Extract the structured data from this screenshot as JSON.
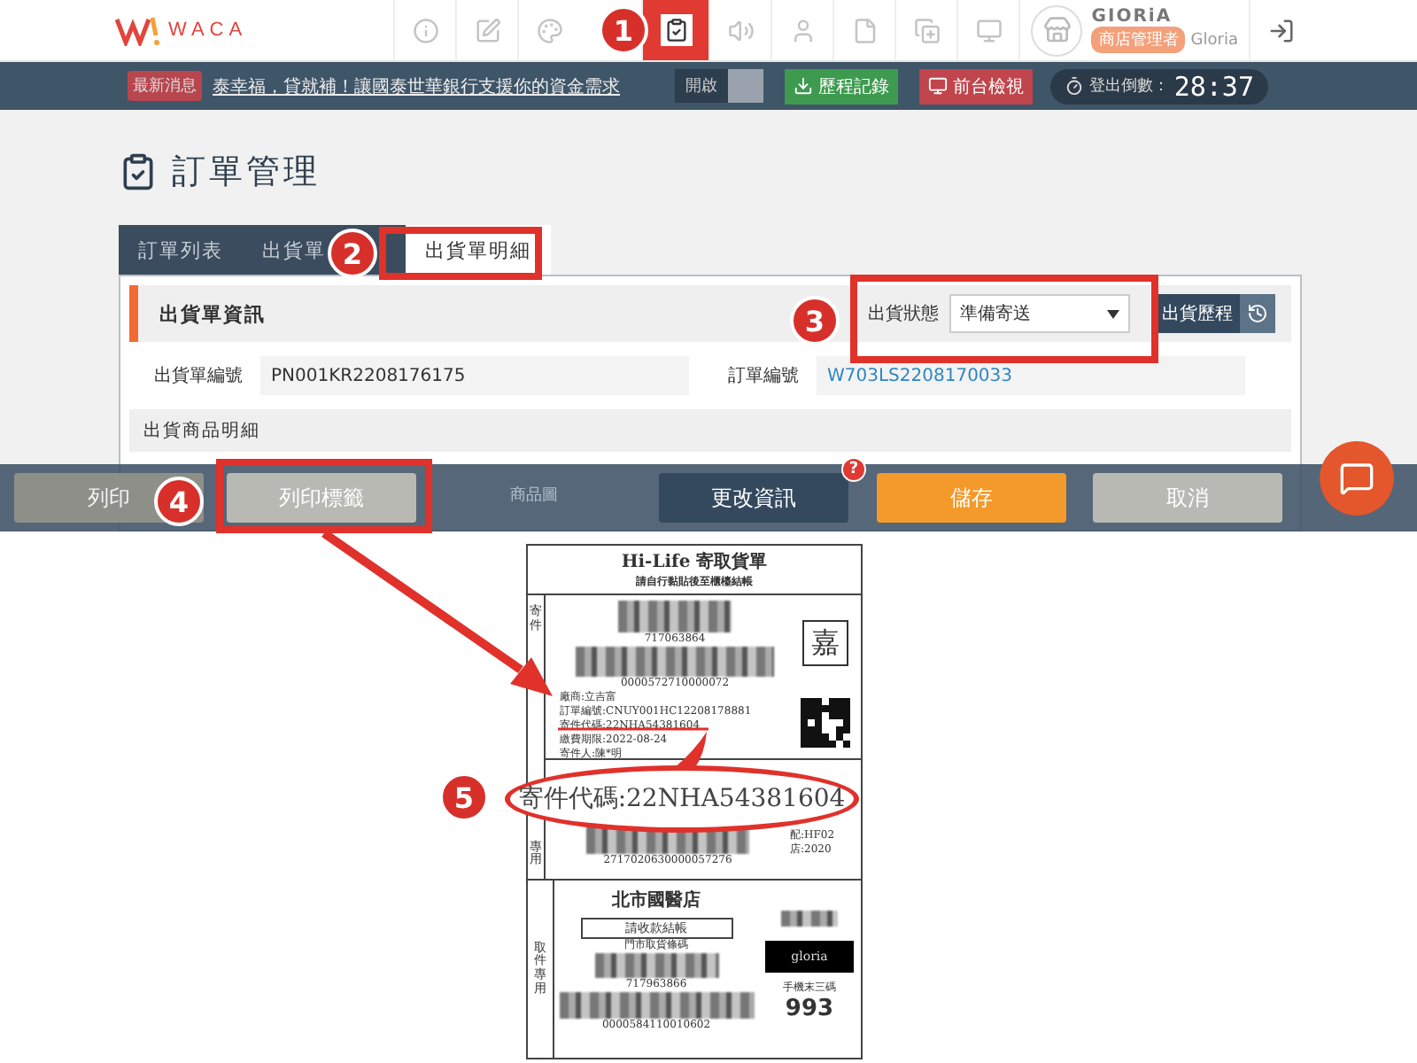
{
  "header": {
    "logo": "WACA",
    "nav": [
      {
        "kind": "info",
        "selected": false
      },
      {
        "kind": "edit",
        "selected": false
      },
      {
        "kind": "palette",
        "selected": false
      },
      {
        "kind": "clipboard",
        "selected": true
      },
      {
        "kind": "speaker",
        "selected": false
      },
      {
        "kind": "user",
        "selected": false
      },
      {
        "kind": "file",
        "selected": false
      },
      {
        "kind": "copy",
        "selected": false
      },
      {
        "kind": "monitor",
        "selected": false
      }
    ],
    "user": {
      "name": "GIORiA",
      "role": "商店管理者",
      "account": "Gloria"
    }
  },
  "news_bar": {
    "badge": "最新消息",
    "headline": "泰幸福，貸就補！讓國泰世華銀行支援你的資金需求",
    "toggle_label": "開啟",
    "toggle_on": false,
    "history_button": "歷程記錄",
    "preview_button": "前台檢視",
    "countdown_label": "登出倒數：",
    "countdown": "28:37"
  },
  "page_title": "訂單管理",
  "tabs": [
    {
      "label": "訂單列表",
      "selected": false
    },
    {
      "label": "出貨單",
      "selected": false
    },
    {
      "label": "出貨單明細",
      "selected": true
    }
  ],
  "panel": {
    "title": "出貨單資訊",
    "status_label": "出貨狀態",
    "status_value": "準備寄送",
    "history_button": "出貨歷程",
    "fields": [
      {
        "label": "出貨單編號",
        "value": "PN001KR2208176175",
        "kind": "text"
      },
      {
        "label": "訂單編號",
        "value": "W703LS2208170033",
        "kind": "link"
      }
    ],
    "items_title": "出貨商品明細",
    "items_column": "商品圖"
  },
  "action_bar": {
    "buttons": [
      {
        "label": "列印",
        "kind": "disabled"
      },
      {
        "label": "列印標籤",
        "kind": "default"
      },
      {
        "label": "更改資訊",
        "kind": "dark",
        "help": "?"
      },
      {
        "label": "儲存",
        "kind": "primary"
      },
      {
        "label": "取消",
        "kind": "default"
      }
    ]
  },
  "label_preview": {
    "title": "Hi-Life 寄取貨單",
    "subtitle": "請自行黏貼後至櫃檯結帳",
    "sender_side_top": "寄件",
    "sender_side_bottom": "專用",
    "number_1": "717063864",
    "number_2": "0000572710000072",
    "stamp": "嘉",
    "sender_lines": [
      "廠商:立吉富",
      "訂單編號:CNUY001HC12208178881",
      "寄件代碼:22NHA54381604",
      "繳費期限:2022-08-24",
      "寄件人:陳*明"
    ],
    "number_3": "2717020630000057276",
    "route_lines": [
      "配:HF02",
      "店:2020"
    ],
    "pickup_side": "取件專用",
    "store": "北市國醫店",
    "pay_note": "請收款結帳",
    "pickup_caption": "門市取貨條碼",
    "number_4": "717963866",
    "number_5": "0000584110010602",
    "brand": "gloria",
    "phone_caption": "手機末三碼",
    "phone_digits": "993"
  },
  "annotations": [
    {
      "number": "1",
      "kind": "badge",
      "arrow": false
    },
    {
      "number": "2",
      "kind": "frame",
      "arrow": false
    },
    {
      "number": "3",
      "kind": "frame",
      "arrow": false
    },
    {
      "number": "4",
      "kind": "frame",
      "arrow": true
    },
    {
      "number": "5",
      "kind": "ellipse",
      "arrow": false,
      "text": "寄件代碼:22NHA54381604"
    }
  ]
}
